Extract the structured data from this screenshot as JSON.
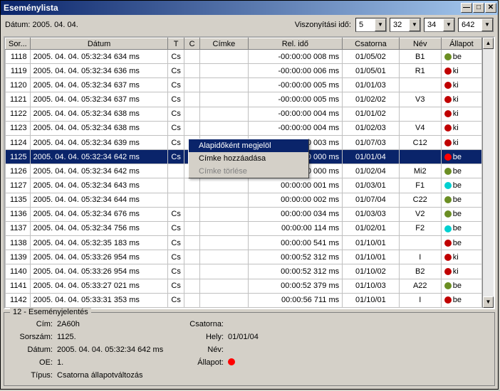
{
  "window": {
    "title": "Eseménylista"
  },
  "toolbar": {
    "date_label": "Dátum:",
    "date_value": "2005. 04. 04.",
    "ref_label": "Viszonyítási idő:",
    "h": "5",
    "m": "32",
    "s": "34",
    "ms": "642"
  },
  "columns": {
    "sor": "Sor...",
    "datum": "Dátum",
    "t": "T",
    "c": "C",
    "cimke": "Címke",
    "relido": "Rel. idő",
    "csatorna": "Csatorna",
    "nev": "Név",
    "allapot": "Állapot"
  },
  "rows": [
    {
      "sor": "1118",
      "datum": "2005. 04. 04. 05:32:34 634 ms",
      "t": "Cs",
      "c": "",
      "cimke": "",
      "rel": "-00:00:00 008 ms",
      "csat": "01/05/02",
      "nev": "B1",
      "dot": "#6b8e23",
      "all": "be"
    },
    {
      "sor": "1119",
      "datum": "2005. 04. 04. 05:32:34 636 ms",
      "t": "Cs",
      "c": "",
      "cimke": "",
      "rel": "-00:00:00 006 ms",
      "csat": "01/05/01",
      "nev": "R1",
      "dot": "#c00000",
      "all": "ki"
    },
    {
      "sor": "1120",
      "datum": "2005. 04. 04. 05:32:34 637 ms",
      "t": "Cs",
      "c": "",
      "cimke": "",
      "rel": "-00:00:00 005 ms",
      "csat": "01/01/03",
      "nev": "",
      "dot": "#c00000",
      "all": "ki"
    },
    {
      "sor": "1121",
      "datum": "2005. 04. 04. 05:32:34 637 ms",
      "t": "Cs",
      "c": "",
      "cimke": "",
      "rel": "-00:00:00 005 ms",
      "csat": "01/02/02",
      "nev": "V3",
      "dot": "#c00000",
      "all": "ki"
    },
    {
      "sor": "1122",
      "datum": "2005. 04. 04. 05:32:34 638 ms",
      "t": "Cs",
      "c": "",
      "cimke": "",
      "rel": "-00:00:00 004 ms",
      "csat": "01/01/02",
      "nev": "",
      "dot": "#c00000",
      "all": "ki"
    },
    {
      "sor": "1123",
      "datum": "2005. 04. 04. 05:32:34 638 ms",
      "t": "Cs",
      "c": "",
      "cimke": "",
      "rel": "-00:00:00 004 ms",
      "csat": "01/02/03",
      "nev": "V4",
      "dot": "#c00000",
      "all": "ki"
    },
    {
      "sor": "1124",
      "datum": "2005. 04. 04. 05:32:34 639 ms",
      "t": "Cs",
      "c": "",
      "cimke": "",
      "rel": "-00:00:00 003 ms",
      "csat": "01/07/03",
      "nev": "C12",
      "dot": "#c00000",
      "all": "ki"
    },
    {
      "sor": "1125",
      "datum": "2005. 04. 04. 05:32:34 642 ms",
      "t": "Cs",
      "c": "",
      "cimke": "",
      "rel": "00:00:00 000 ms",
      "csat": "01/01/04",
      "nev": "",
      "dot": "#ff0000",
      "all": "be"
    },
    {
      "sor": "1126",
      "datum": "2005. 04. 04. 05:32:34 642 ms",
      "t": "",
      "c": "",
      "cimke": "",
      "rel": "00:00:00 000 ms",
      "csat": "01/02/04",
      "nev": "Mi2",
      "dot": "#6b8e23",
      "all": "be"
    },
    {
      "sor": "1127",
      "datum": "2005. 04. 04. 05:32:34 643 ms",
      "t": "",
      "c": "",
      "cimke": "",
      "rel": "00:00:00 001 ms",
      "csat": "01/03/01",
      "nev": "F1",
      "dot": "#00d0d0",
      "all": "be"
    },
    {
      "sor": "1135",
      "datum": "2005. 04. 04. 05:32:34 644 ms",
      "t": "",
      "c": "",
      "cimke": "",
      "rel": "00:00:00 002 ms",
      "csat": "01/07/04",
      "nev": "C22",
      "dot": "#6b8e23",
      "all": "be"
    },
    {
      "sor": "1136",
      "datum": "2005. 04. 04. 05:32:34 676 ms",
      "t": "Cs",
      "c": "",
      "cimke": "",
      "rel": "00:00:00 034 ms",
      "csat": "01/03/03",
      "nev": "V2",
      "dot": "#6b8e23",
      "all": "be"
    },
    {
      "sor": "1137",
      "datum": "2005. 04. 04. 05:32:34 756 ms",
      "t": "Cs",
      "c": "",
      "cimke": "",
      "rel": "00:00:00 114 ms",
      "csat": "01/02/01",
      "nev": "F2",
      "dot": "#00d0d0",
      "all": "be"
    },
    {
      "sor": "1138",
      "datum": "2005. 04. 04. 05:32:35 183 ms",
      "t": "Cs",
      "c": "",
      "cimke": "",
      "rel": "00:00:00 541 ms",
      "csat": "01/10/01",
      "nev": "",
      "dot": "#c00000",
      "all": "be"
    },
    {
      "sor": "1139",
      "datum": "2005. 04. 04. 05:33:26 954 ms",
      "t": "Cs",
      "c": "",
      "cimke": "",
      "rel": "00:00:52 312 ms",
      "csat": "01/10/01",
      "nev": "I",
      "dot": "#c00000",
      "all": "ki"
    },
    {
      "sor": "1140",
      "datum": "2005. 04. 04. 05:33:26 954 ms",
      "t": "Cs",
      "c": "",
      "cimke": "",
      "rel": "00:00:52 312 ms",
      "csat": "01/10/02",
      "nev": "B2",
      "dot": "#c00000",
      "all": "ki"
    },
    {
      "sor": "1141",
      "datum": "2005. 04. 04. 05:33:27 021 ms",
      "t": "Cs",
      "c": "",
      "cimke": "",
      "rel": "00:00:52 379 ms",
      "csat": "01/10/03",
      "nev": "A22",
      "dot": "#6b8e23",
      "all": "be"
    },
    {
      "sor": "1142",
      "datum": "2005. 04. 04. 05:33:31 353 ms",
      "t": "Cs",
      "c": "",
      "cimke": "",
      "rel": "00:00:56 711 ms",
      "csat": "01/10/01",
      "nev": "I",
      "dot": "#c00000",
      "all": "be"
    }
  ],
  "selected_index": 7,
  "context_menu": {
    "mark": "Alapidőként megjelöl",
    "add_label": "Címke hozzáadása",
    "del_label": "Címke törlése"
  },
  "details": {
    "legend": "12 - Eseményjelentés",
    "cim_l": "Cím:",
    "cim_v": "2A60h",
    "sor_l": "Sorszám:",
    "sor_v": "1125.",
    "dat_l": "Dátum:",
    "dat_v": "2005. 04. 04. 05:32:34 642 ms",
    "oe_l": "OE:",
    "oe_v": "1.",
    "tip_l": "Típus:",
    "tip_v": "Csatorna állapotváltozás",
    "csat_l": "Csatorna:",
    "csat_v": "",
    "hely_l": "Hely:",
    "hely_v": "01/01/04",
    "nev_l": "Név:",
    "nev_v": "",
    "all_l": "Állapot:",
    "all_dot": "#ff0000"
  }
}
